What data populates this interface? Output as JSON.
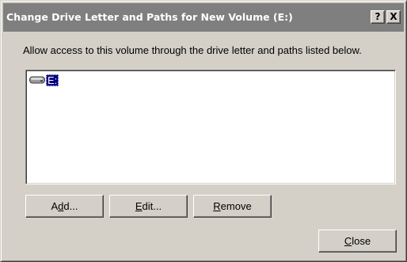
{
  "dialog": {
    "title": "Change Drive Letter and Paths for New Volume (E:)",
    "help_label": "?",
    "close_label": "X",
    "description": "Allow access to this volume through the drive letter and paths listed below."
  },
  "list": {
    "items": [
      {
        "label": "E:",
        "icon": "drive-icon",
        "selected": true
      }
    ]
  },
  "buttons": {
    "add": {
      "pre": "A",
      "acc": "d",
      "post": "d..."
    },
    "edit": {
      "pre": "",
      "acc": "E",
      "post": "dit..."
    },
    "remove": {
      "pre": "",
      "acc": "R",
      "post": "emove"
    },
    "close": {
      "pre": "",
      "acc": "C",
      "post": "lose"
    }
  },
  "colors": {
    "face": "#d4d0c8",
    "titlebar": "#7f7f7f",
    "selection": "#000080"
  }
}
